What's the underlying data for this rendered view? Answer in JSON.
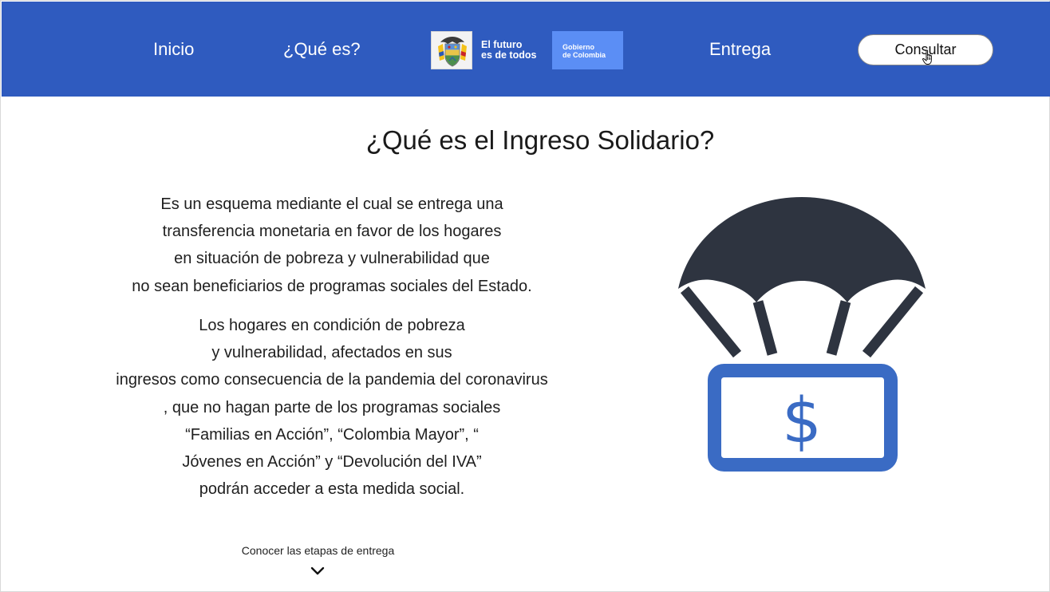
{
  "header": {
    "nav": {
      "inicio": "Inicio",
      "que_es": "¿Qué es?",
      "entrega": "Entrega"
    },
    "slogan_line1": "El futuro",
    "slogan_line2": "es de todos",
    "gov_line1": "Gobierno",
    "gov_line2": "de Colombia",
    "consult_label": "Consultar",
    "background_color": "#2f5bbf",
    "gov_badge_color": "#5b8ef5"
  },
  "main": {
    "title": "¿Qué es el Ingreso Solidario?",
    "paragraph1": [
      "Es un esquema mediante el cual se entrega una",
      "transferencia monetaria en favor de los hogares",
      "en situación de pobreza y vulnerabilidad que",
      "no sean beneficiarios de programas sociales del Estado."
    ],
    "paragraph2": [
      "Los hogares en condición de pobreza",
      "y vulnerabilidad, afectados en sus",
      "ingresos como consecuencia de la pandemia del coronavirus",
      ", que no hagan parte de los programas sociales",
      "“Familias en Acción”, “Colombia Mayor”, “",
      "Jóvenes en Acción” y “Devolución del IVA”",
      "podrán acceder a esta medida social."
    ],
    "scroll_link": "Conocer las etapas de entrega",
    "illustration": {
      "symbol": "$",
      "parachute_color": "#2e3440",
      "money_color": "#3a6bc4"
    }
  },
  "icons": {
    "coat_of_arms": "colombia-coat-of-arms-icon",
    "chevron": "chevron-down-icon",
    "cursor": "hand-pointer-cursor-icon",
    "illustration": "parachute-money-icon"
  }
}
